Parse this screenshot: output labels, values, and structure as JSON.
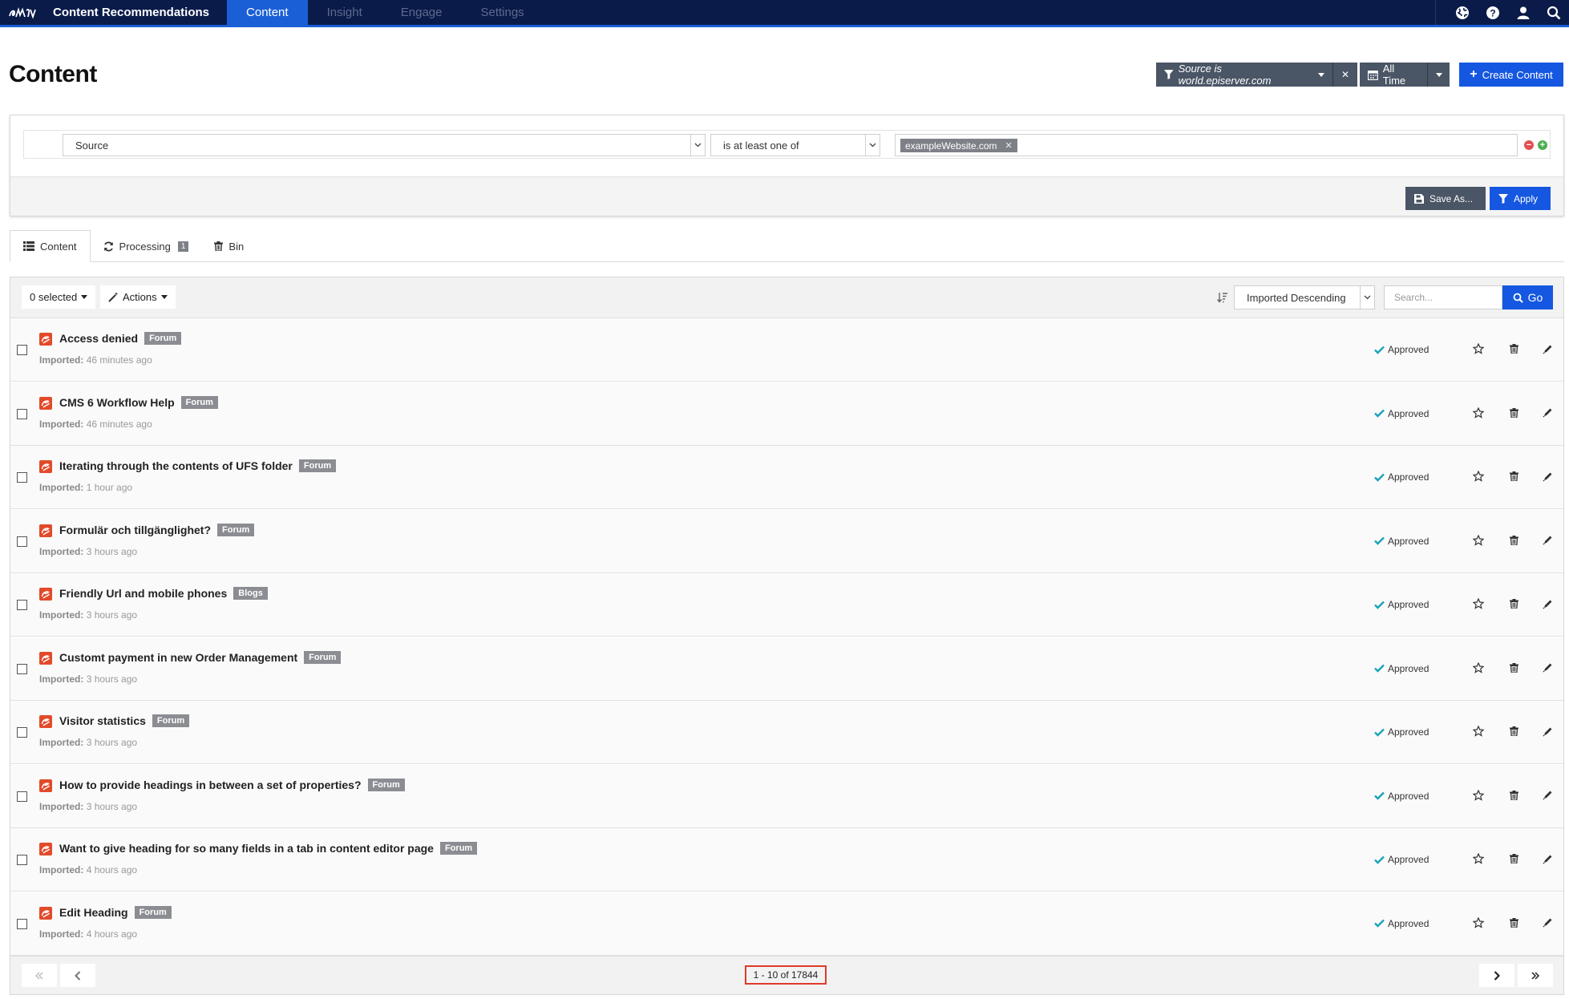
{
  "topnav": {
    "app_title": "Content Recommendations",
    "tabs": [
      {
        "label": "Content",
        "active": true
      },
      {
        "label": "Insight",
        "active": false
      },
      {
        "label": "Engage",
        "active": false
      },
      {
        "label": "Settings",
        "active": false
      }
    ],
    "icons": [
      "globe-icon",
      "help-icon",
      "user-icon",
      "search-icon"
    ]
  },
  "header": {
    "page_title": "Content",
    "source_filter_label": "Source is world.episerver.com",
    "date_range_label": "All Time",
    "create_label": "Create Content"
  },
  "filter": {
    "field": "Source",
    "operator": "is at least one of",
    "values": [
      "exampleWebsite.com"
    ],
    "save_as_label": "Save As...",
    "apply_label": "Apply"
  },
  "tabs": {
    "content_label": "Content",
    "processing_label": "Processing",
    "processing_count": "1",
    "bin_label": "Bin"
  },
  "toolbar": {
    "selected_label": "0 selected",
    "actions_label": "Actions",
    "sort_value": "Imported Descending",
    "search_placeholder": "Search...",
    "go_label": "Go"
  },
  "rows": [
    {
      "title": "Access denied",
      "category": "Forum",
      "imported_label": "Imported:",
      "imported_time": "46 minutes ago",
      "status": "Approved"
    },
    {
      "title": "CMS 6 Workflow Help",
      "category": "Forum",
      "imported_label": "Imported:",
      "imported_time": "46 minutes ago",
      "status": "Approved"
    },
    {
      "title": "Iterating through the contents of UFS folder",
      "category": "Forum",
      "imported_label": "Imported:",
      "imported_time": "1 hour ago",
      "status": "Approved"
    },
    {
      "title": "Formulär och tillgänglighet?",
      "category": "Forum",
      "imported_label": "Imported:",
      "imported_time": "3 hours ago",
      "status": "Approved"
    },
    {
      "title": "Friendly Url and mobile phones",
      "category": "Blogs",
      "imported_label": "Imported:",
      "imported_time": "3 hours ago",
      "status": "Approved"
    },
    {
      "title": "Customt payment in new Order Management",
      "category": "Forum",
      "imported_label": "Imported:",
      "imported_time": "3 hours ago",
      "status": "Approved"
    },
    {
      "title": "Visitor statistics",
      "category": "Forum",
      "imported_label": "Imported:",
      "imported_time": "3 hours ago",
      "status": "Approved"
    },
    {
      "title": "How to provide headings in between a set of properties?",
      "category": "Forum",
      "imported_label": "Imported:",
      "imported_time": "3 hours ago",
      "status": "Approved"
    },
    {
      "title": "Want to give heading for so many fields in a tab in content editor page",
      "category": "Forum",
      "imported_label": "Imported:",
      "imported_time": "4 hours ago",
      "status": "Approved"
    },
    {
      "title": "Edit Heading",
      "category": "Forum",
      "imported_label": "Imported:",
      "imported_time": "4 hours ago",
      "status": "Approved"
    }
  ],
  "pager": {
    "info": "1 - 10 of 17844"
  },
  "colors": {
    "nav_bg": "#0a1b4a",
    "accent": "#1557e0",
    "dark_button": "#4a5566",
    "content_type_icon": "#e24a2a",
    "approved_check": "#1aa3b8",
    "highlight": "#e03a2a"
  }
}
